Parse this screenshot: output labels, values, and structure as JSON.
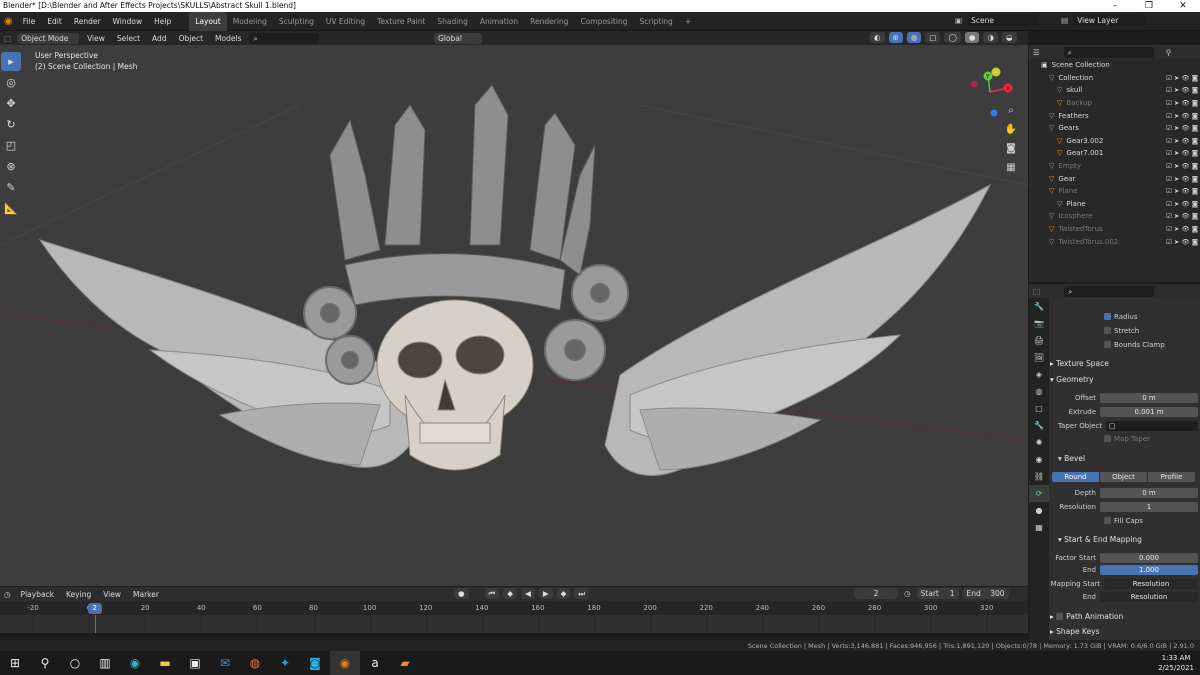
{
  "window": {
    "title": "Blender* [D:\\Blender and After Effects Projects\\SKULLS\\Abstract Skull 1.blend]",
    "min": "–",
    "max": "❐",
    "close": "✕"
  },
  "menus": [
    "File",
    "Edit",
    "Render",
    "Window",
    "Help"
  ],
  "workspaces": [
    "Layout",
    "Modeling",
    "Sculpting",
    "UV Editing",
    "Texture Paint",
    "Shading",
    "Animation",
    "Rendering",
    "Compositing",
    "Scripting"
  ],
  "add_ws": "+",
  "scene": "Scene",
  "view_layer": "View Layer",
  "viewport_header": {
    "mode": "Object Mode",
    "view": "View",
    "select": "Select",
    "add": "Add",
    "object": "Object",
    "models": "Models",
    "transform": "Global"
  },
  "overlay": {
    "line1": "User Perspective",
    "line2": "(2) Scene Collection | Mesh"
  },
  "gizmo": {
    "x": "X",
    "y": "Y",
    "z": "Z"
  },
  "outliner": {
    "root": "Scene Collection",
    "rows": [
      {
        "name": "Collection",
        "dim": false
      },
      {
        "name": "skull",
        "dim": false
      },
      {
        "name": "Backup",
        "dim": true
      },
      {
        "name": "Feathers",
        "dim": false
      },
      {
        "name": "Gears",
        "dim": false
      },
      {
        "name": "Gear3.002",
        "dim": false
      },
      {
        "name": "Gear7.001",
        "dim": false
      },
      {
        "name": "Empty",
        "dim": true
      },
      {
        "name": "Gear",
        "dim": false
      },
      {
        "name": "Plane",
        "dim": true
      },
      {
        "name": "Plane",
        "dim": false
      },
      {
        "name": "Icosphere",
        "dim": true
      },
      {
        "name": "TwistedTorus",
        "dim": true
      },
      {
        "name": "TwistedTorus.002",
        "dim": true
      }
    ]
  },
  "props": {
    "radius": "Radius",
    "stretch": "Stretch",
    "bounds_clamp": "Bounds Clamp",
    "texture_space": "Texture Space",
    "geometry": "Geometry",
    "offset_label": "Offset",
    "offset": "0 m",
    "extrude_label": "Extrude",
    "extrude": "0.001 m",
    "taper_label": "Taper Object",
    "map_taper": "Map Taper",
    "bevel": "Bevel",
    "round": "Round",
    "object": "Object",
    "profile": "Profile",
    "depth_label": "Depth",
    "depth": "0 m",
    "resolution_label": "Resolution",
    "resolution": "1",
    "fill_caps": "Fill Caps",
    "mapping": "Start & End Mapping",
    "factor_start_label": "Factor Start",
    "factor_start": "0.000",
    "end_label": "End",
    "end": "1.000",
    "mapping_start_label": "Mapping Start",
    "mapping_start": "Resolution",
    "end2_label": "End",
    "end2": "Resolution",
    "path_animation": "Path Animation",
    "shape_keys": "Shape Keys"
  },
  "timeline": {
    "playback": "Playback",
    "keying": "Keying",
    "view": "View",
    "marker": "Marker",
    "frame": "2",
    "start_label": "Start",
    "start": "1",
    "end_label": "End",
    "end": "300",
    "ticks": [
      "-20",
      "0",
      "20",
      "40",
      "60",
      "80",
      "100",
      "120",
      "140",
      "160",
      "180",
      "200",
      "220",
      "240",
      "260",
      "280",
      "300",
      "320"
    ],
    "current": "2"
  },
  "status": "Scene Collection | Mesh | Verts:3,146,881 | Faces:946,956 | Tris:1,891,120 | Objects:0/78 | Memory: 1.73 GiB | VRAM: 0.6/6.0 GiB | 2.91.0",
  "clock": {
    "time": "1:33 AM",
    "date": "2/25/2021"
  }
}
